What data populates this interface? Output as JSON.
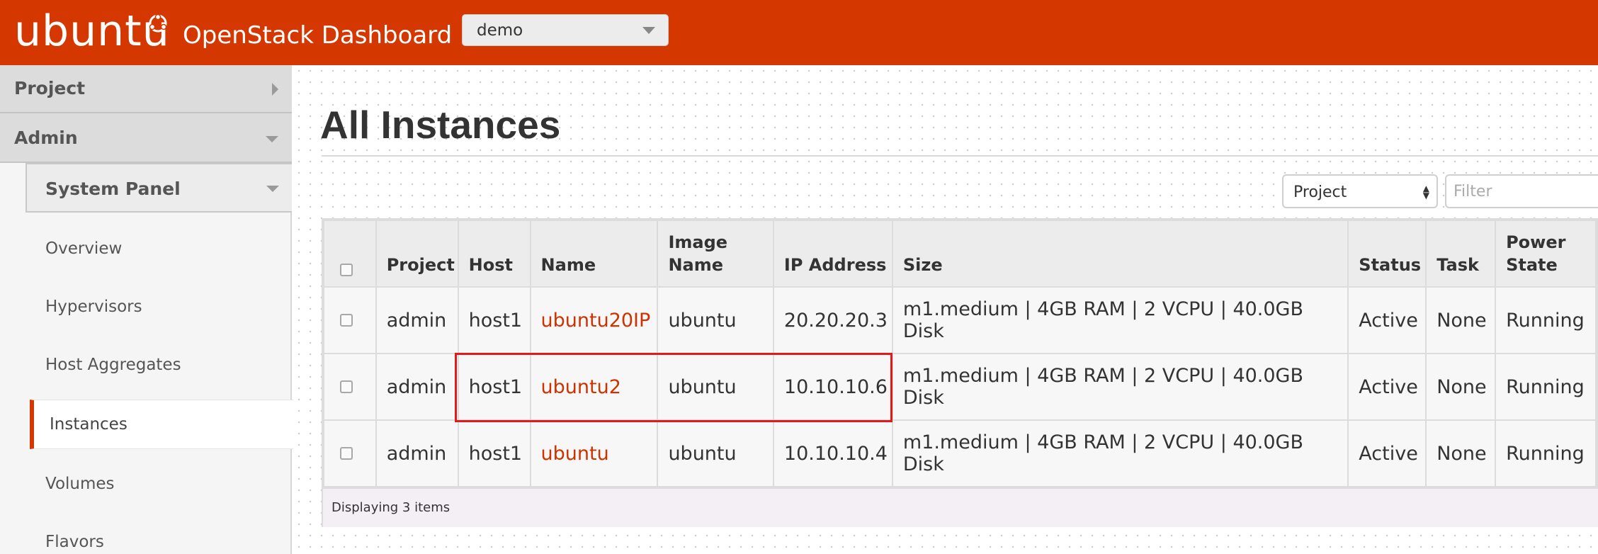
{
  "header": {
    "brand": "ubuntu",
    "app_title": "OpenStack Dashboard",
    "project_select": "demo"
  },
  "sidebar": {
    "project_label": "Project",
    "admin_label": "Admin",
    "system_panel_label": "System Panel",
    "items": [
      {
        "label": "Overview"
      },
      {
        "label": "Hypervisors"
      },
      {
        "label": "Host Aggregates"
      },
      {
        "label": "Instances",
        "active": true
      },
      {
        "label": "Volumes"
      },
      {
        "label": "Flavors"
      }
    ]
  },
  "main": {
    "page_title": "All Instances",
    "filter_field_select": "Project",
    "filter_placeholder": "Filter",
    "table": {
      "columns": [
        "Project",
        "Host",
        "Name",
        "Image Name",
        "IP Address",
        "Size",
        "Status",
        "Task",
        "Power State"
      ],
      "rows": [
        {
          "project": "admin",
          "host": "host1",
          "name": "ubuntu20IP",
          "image": "ubuntu",
          "ip": "20.20.20.3",
          "size": "m1.medium | 4GB RAM | 2 VCPU | 40.0GB Disk",
          "status": "Active",
          "task": "None",
          "power": "Running"
        },
        {
          "project": "admin",
          "host": "host1",
          "name": "ubuntu2",
          "image": "ubuntu",
          "ip": "10.10.10.6",
          "size": "m1.medium | 4GB RAM | 2 VCPU | 40.0GB Disk",
          "status": "Active",
          "task": "None",
          "power": "Running"
        },
        {
          "project": "admin",
          "host": "host1",
          "name": "ubuntu",
          "image": "ubuntu",
          "ip": "10.10.10.4",
          "size": "m1.medium | 4GB RAM | 2 VCPU | 40.0GB Disk",
          "status": "Active",
          "task": "None",
          "power": "Running"
        }
      ],
      "footer": "Displaying 3 items"
    }
  },
  "colors": {
    "brand_orange": "#d53700",
    "link_red": "#cc3300",
    "highlight_red": "#e11b1b"
  }
}
